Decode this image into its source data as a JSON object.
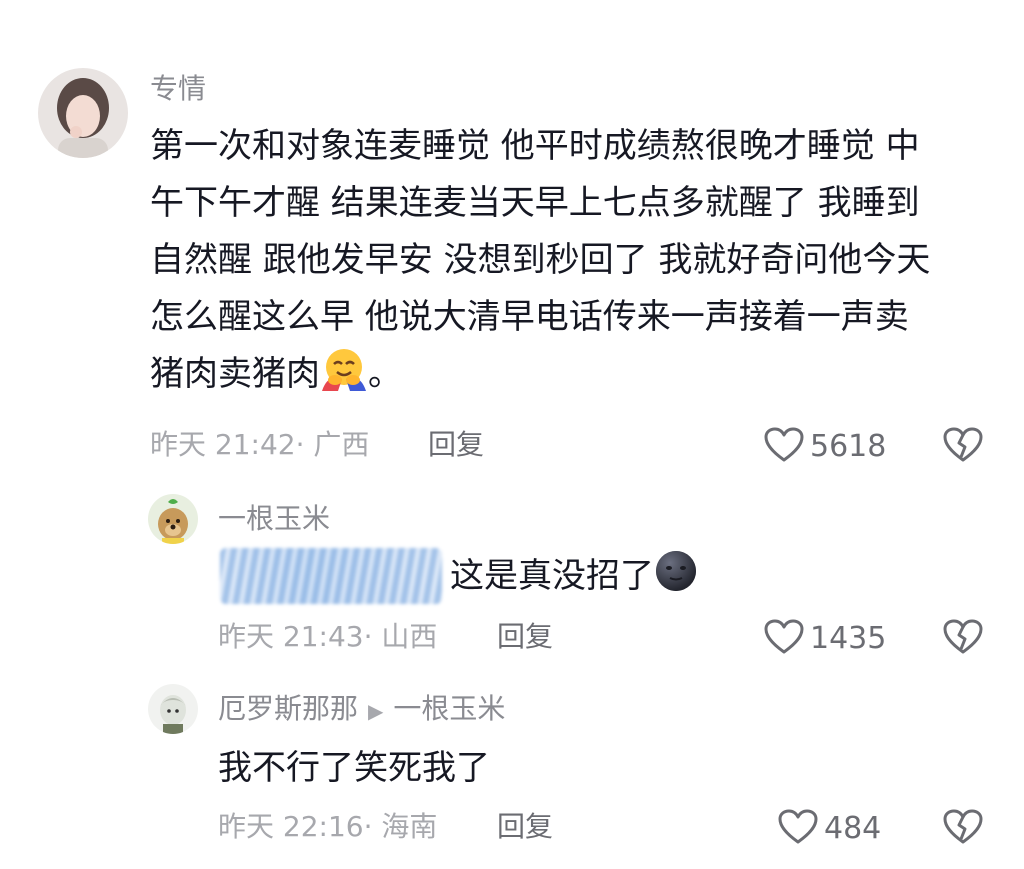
{
  "comments": [
    {
      "username": "专情",
      "content_lines": [
        "第一次和对象连麦睡觉 他平时成绩熬很晚才睡觉 中",
        "午下午才醒 结果连麦当天早上七点多就醒了 我睡到",
        "自然醒 跟他发早安 没想到秒回了 我就好奇问他今天",
        "怎么醒这么早 他说大清早电话传来一声接着一声卖"
      ],
      "content_last": "猪肉卖猪肉",
      "content_tail": "。",
      "emoji": "hugging-face-emoji",
      "time": "昨天 21:42",
      "location": "· 广西",
      "reply_label": "回复",
      "likes": "5618"
    },
    {
      "username": "一根玉米",
      "content": "这是真没招了",
      "emoji": "new-moon-face-emoji",
      "time": "昨天 21:43",
      "location": "· 山西",
      "reply_label": "回复",
      "likes": "1435"
    },
    {
      "username": "厄罗斯那那",
      "reply_to": "一根玉米",
      "content": "我不行了笑死我了",
      "time": "昨天 22:16",
      "location": "· 海南",
      "reply_label": "回复",
      "likes": "484"
    }
  ],
  "colors": {
    "text": "#161823",
    "username": "#8a8b91",
    "meta": "#a7a8ad"
  }
}
